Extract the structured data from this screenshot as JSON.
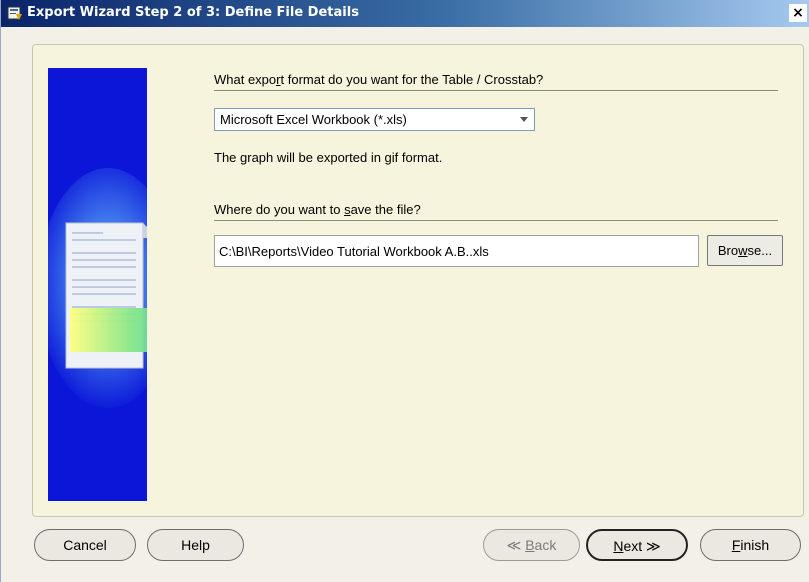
{
  "window": {
    "title": "Export Wizard Step 2 of 3: Define File Details",
    "close_glyph": "×"
  },
  "format_section": {
    "question_pre": "What expo",
    "question_key": "r",
    "question_post": "t format do you want for the Table / Crosstab?",
    "selected_format": "Microsoft Excel Workbook (*.xls)",
    "graph_note": "The graph will be exported in gif format."
  },
  "save_section": {
    "question_pre": "Where do you want to ",
    "question_key": "s",
    "question_post": "ave the file?",
    "path_value": "C:\\BI\\Reports\\Video Tutorial Workbook A.B..xls",
    "browse_pre": "Bro",
    "browse_key": "w",
    "browse_post": "se..."
  },
  "buttons": {
    "cancel": "Cancel",
    "help": "Help",
    "back_arrow": "≪",
    "back_key": "B",
    "back_post": "ack",
    "next_key": "N",
    "next_post": "ext",
    "next_arrow": "≫",
    "finish_key": "F",
    "finish_post": "inish"
  },
  "icons": {
    "window_icon": "wizard-app-icon",
    "side_graphic": "export-document-arrow-icon",
    "dropdown": "chevron-down-icon"
  },
  "colors": {
    "title_start": "#0a246a",
    "title_end": "#a6caf0",
    "side_blue": "#0b16d8",
    "panel_bg": "#f6f4dc"
  }
}
